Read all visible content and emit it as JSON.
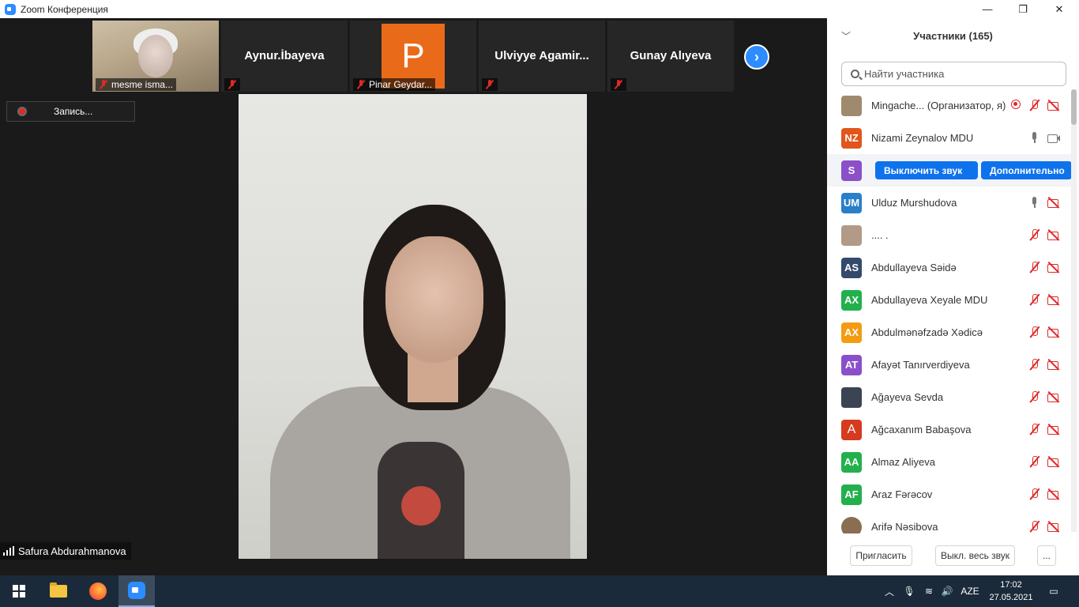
{
  "window": {
    "title": "Zoom Конференция",
    "minimize_glyph": "—",
    "restore_glyph": "❐",
    "close_glyph": "✕"
  },
  "video_strip": {
    "tiles": [
      {
        "name": "mesme isma...",
        "kind": "photo",
        "muted": true
      },
      {
        "name": "Aynur.İbayeva",
        "kind": "name",
        "muted": true
      },
      {
        "name": "Pinar Geydar...",
        "avatar_letter": "P",
        "avatar_color": "#e96b1a",
        "kind": "avatar",
        "muted": true
      },
      {
        "name": "Ulviyye  Agamir...",
        "kind": "name",
        "muted": true
      },
      {
        "name": "Gunay Alıyeva",
        "kind": "name",
        "muted": true
      }
    ],
    "next_icon": "chevron-right-icon"
  },
  "recording": {
    "label": "Запись..."
  },
  "active_speaker": {
    "name": "Safura Abdurahmanova"
  },
  "participants_panel": {
    "title": "Участники (165)",
    "search_placeholder": "Найти участника",
    "participants": [
      {
        "name": "Mingache... (Организатор, я)",
        "avatar_type": "photo",
        "avatar_color": "#a08a6e",
        "initials": "",
        "recording": true,
        "mic": "off",
        "cam": "off"
      },
      {
        "name": "Nizami Zeynalov MDU",
        "avatar_type": "initials",
        "avatar_color": "#e0561b",
        "initials": "NZ",
        "mic": "on",
        "cam": "on"
      },
      {
        "name": "",
        "avatar_type": "initials",
        "avatar_color": "#8a4fc9",
        "initials": "S",
        "hover": true,
        "buttons": [
          "Выключить звук",
          "Дополнительно"
        ]
      },
      {
        "name": "Ulduz Murshudova",
        "avatar_type": "initials",
        "avatar_color": "#2a7fc9",
        "initials": "UM",
        "mic": "on",
        "cam": "off"
      },
      {
        "name": ".... .",
        "avatar_type": "photo",
        "avatar_color": "#b39a86",
        "initials": "",
        "mic": "off",
        "cam": "off"
      },
      {
        "name": "Abdullayeva Səidə",
        "avatar_type": "initials",
        "avatar_color": "#344a6b",
        "initials": "AS",
        "mic": "off",
        "cam": "off"
      },
      {
        "name": "Abdullayeva Xeyale MDU",
        "avatar_type": "initials",
        "avatar_color": "#22b04c",
        "initials": "AX",
        "mic": "off",
        "cam": "off"
      },
      {
        "name": "Abdulmənəfzadə Xədicə",
        "avatar_type": "initials",
        "avatar_color": "#f39c12",
        "initials": "AX",
        "mic": "off",
        "cam": "off"
      },
      {
        "name": "Afayət Tanırverdiyeva",
        "avatar_type": "initials",
        "avatar_color": "#8a4fc9",
        "initials": "AT",
        "mic": "off",
        "cam": "off"
      },
      {
        "name": "Ağayeva Sevda",
        "avatar_type": "photo",
        "avatar_color": "#3b4452",
        "initials": "",
        "mic": "off",
        "cam": "off"
      },
      {
        "name": "Ağcaxanım Babaşova",
        "avatar_type": "initials",
        "avatar_color": "#d63a1f",
        "initials": "A",
        "mic": "off",
        "cam": "off"
      },
      {
        "name": "Almaz Aliyeva",
        "avatar_type": "initials",
        "avatar_color": "#22b04c",
        "initials": "AA",
        "mic": "off",
        "cam": "off"
      },
      {
        "name": "Araz Fərəcov",
        "avatar_type": "initials",
        "avatar_color": "#22b04c",
        "initials": "AF",
        "mic": "off",
        "cam": "off"
      },
      {
        "name": "Arifə Nəsibova",
        "avatar_type": "photo",
        "avatar_color": "#8a6e52",
        "initials": "",
        "mic": "off",
        "cam": "off"
      }
    ],
    "footer": {
      "invite": "Пригласить",
      "mute_all": "Выкл. весь звук",
      "more": "..."
    }
  },
  "taskbar": {
    "language": "AZE",
    "time": "17:02",
    "date": "27.05.2021",
    "tray_chevron": "︿"
  }
}
